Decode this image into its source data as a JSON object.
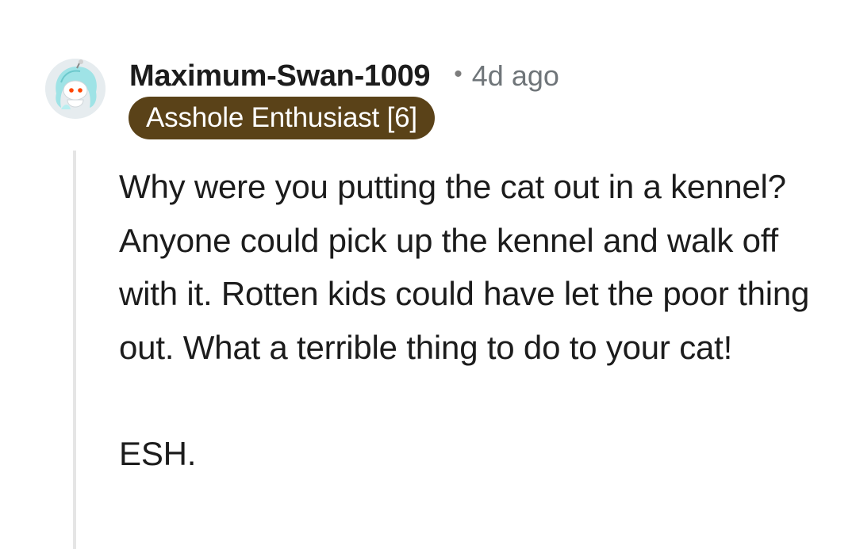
{
  "comment": {
    "username": "Maximum-Swan-1009",
    "separator": "•",
    "timestamp": "4d ago",
    "flair": "Asshole Enthusiast [6]",
    "flair_color": "#5a4218",
    "avatar_icon": "snoo-avatar-icon",
    "paragraphs": [
      "Why were you putting the cat out in a kennel? Anyone could pick up the kennel and walk off with it. Rotten kids could have let the poor thing out. What a terrible thing to do to your cat!",
      "ESH."
    ]
  }
}
